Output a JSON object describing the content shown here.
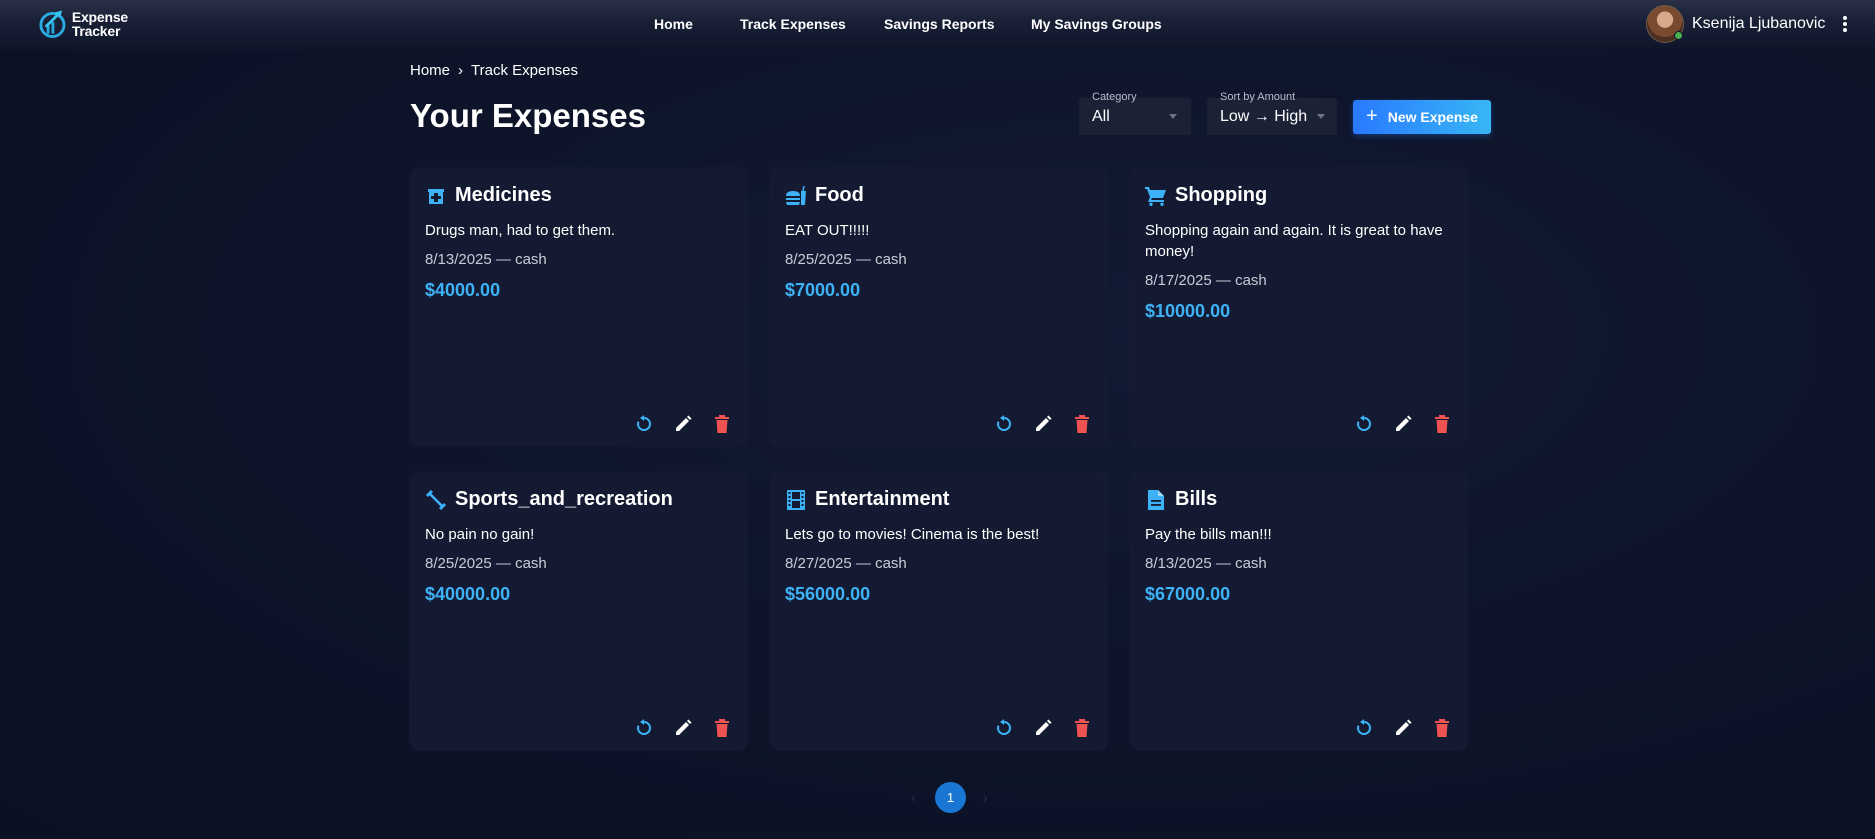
{
  "app": {
    "logo_line1": "Expense",
    "logo_line2": "Tracker"
  },
  "nav": {
    "items": [
      {
        "label": "Home"
      },
      {
        "label": "Track Expenses"
      },
      {
        "label": "Savings Reports"
      },
      {
        "label": "My Savings Groups"
      }
    ]
  },
  "user": {
    "name": "Ksenija Ljubanovic",
    "status": "online"
  },
  "breadcrumb": {
    "home": "Home",
    "separator": "›",
    "current": "Track Expenses"
  },
  "page": {
    "title": "Your Expenses"
  },
  "filters": {
    "category": {
      "label": "Category",
      "value": "All"
    },
    "sort": {
      "label": "Sort by Amount",
      "value": "Low → High"
    }
  },
  "actions": {
    "new_expense_icon": "+",
    "new_expense_label": "New Expense"
  },
  "expenses": [
    {
      "category": "Medicines",
      "icon": "medical-icon",
      "description": "Drugs man, had to get them.",
      "meta": "8/13/2025 — cash",
      "amount": "$4000.00"
    },
    {
      "category": "Food",
      "icon": "fastfood-icon",
      "description": "EAT OUT!!!!!",
      "meta": "8/25/2025 — cash",
      "amount": "$7000.00"
    },
    {
      "category": "Shopping",
      "icon": "shopping-cart-icon",
      "description": "Shopping again and again. It is great to have money!",
      "meta": "8/17/2025 — cash",
      "amount": "$10000.00"
    },
    {
      "category": "Sports_and_recreation",
      "icon": "fitness-icon",
      "description": "No pain no gain!",
      "meta": "8/25/2025 — cash",
      "amount": "$40000.00"
    },
    {
      "category": "Entertainment",
      "icon": "film-icon",
      "description": "Lets go to movies! Cinema is the best!",
      "meta": "8/27/2025 — cash",
      "amount": "$56000.00"
    },
    {
      "category": "Bills",
      "icon": "document-icon",
      "description": "Pay the bills man!!!",
      "meta": "8/13/2025 — cash",
      "amount": "$67000.00"
    }
  ],
  "pagination": {
    "prev": "‹",
    "current": "1",
    "next": "›"
  },
  "colors": {
    "accent": "#3db2f6",
    "primary_button": "#2979ff",
    "delete": "#ef5350",
    "card_bg": "#141a31",
    "page_bg": "#0d1429"
  }
}
